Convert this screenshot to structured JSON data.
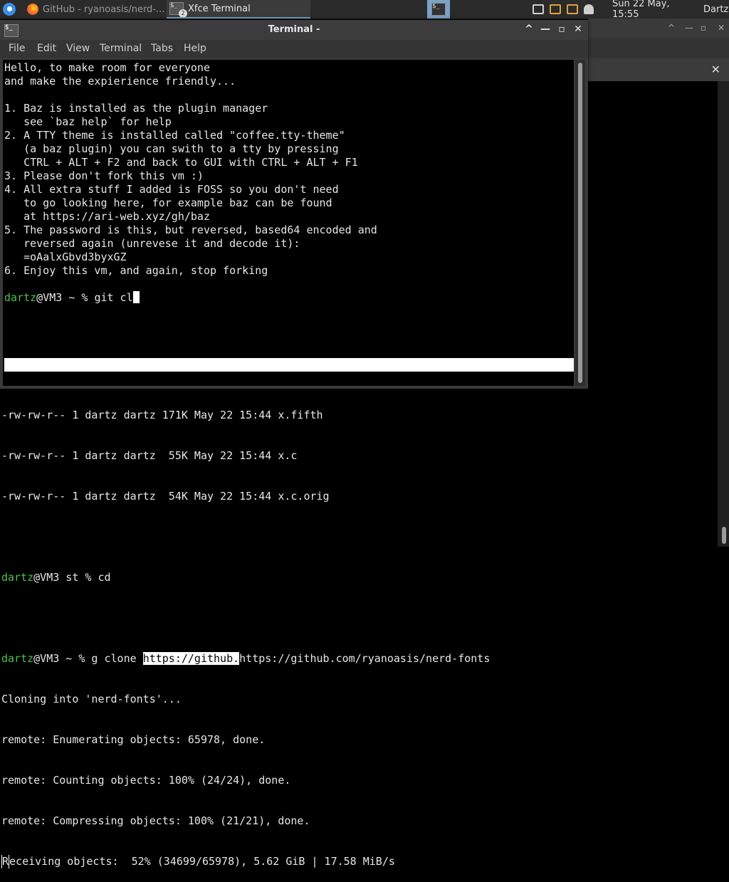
{
  "panel": {
    "tasks": [
      {
        "label": "GitHub - ryanoasis/nerd-..."
      },
      {
        "label": "Xfce Terminal",
        "badge": "2"
      }
    ],
    "clock": "Sun 22 May, 15:55",
    "user": "Dartz"
  },
  "window": {
    "title": "Terminal -",
    "controls": {
      "maximize_up": "^",
      "minimize": "—",
      "maximize": "▫",
      "close": "✕"
    },
    "menu": [
      "File",
      "Edit",
      "View",
      "Terminal",
      "Tabs",
      "Help"
    ]
  },
  "terminal": {
    "lines": [
      "Hello, to make room for everyone",
      "and make the expierience friendly...",
      "",
      "1. Baz is installed as the plugin manager",
      "   see `baz help` for help",
      "2. A TTY theme is installed called \"coffee.tty-theme\"",
      "   (a baz plugin) you can swith to a tty by pressing",
      "   CTRL + ALT + F2 and back to GUI with CTRL + ALT + F1",
      "3. Please don't fork this vm :)",
      "4. All extra stuff I added is FOSS so you don't need",
      "   to go looking here, for example baz can be found",
      "   at https://ari-web.xyz/gh/baz",
      "5. The password is this, but reversed, based64 encoded and",
      "   reversed again (unrevese it and decode it):",
      "   =oAalxGbvd3byxGZ",
      "6. Enjoy this vm, and again, stop forking",
      ""
    ],
    "prompt_user": "dartz",
    "prompt_rest": "@VM3 ~ % ",
    "command": "git cl"
  },
  "background_terminal": {
    "partial_line": "-rw-rw-r-- 1 dartz dartz 171K May 22 15:44 x.fifth",
    "file_lines": [
      "-rw-rw-r-- 1 dartz dartz  55K May 22 15:44 x.c",
      "-rw-rw-r-- 1 dartz dartz  54K May 22 15:44 x.c.orig"
    ],
    "prompt1_user": "dartz",
    "prompt1_rest": "@VM3 st % cd",
    "prompt2_user": "dartz",
    "prompt2_rest": "@VM3 ~ % g clone ",
    "highlight": "https://github.",
    "url_rest": "https://github.com/ryanoasis/nerd-fonts",
    "output": [
      "Cloning into 'nerd-fonts'...",
      "remote: Enumerating objects: 65978, done.",
      "remote: Counting objects: 100% (24/24), done.",
      "remote: Compressing objects: 100% (21/21), done."
    ],
    "last_first_char": "R",
    "last_rest": "eceiving objects:  52% (34699/65978), 5.62 GiB | 17.58 MiB/s"
  }
}
